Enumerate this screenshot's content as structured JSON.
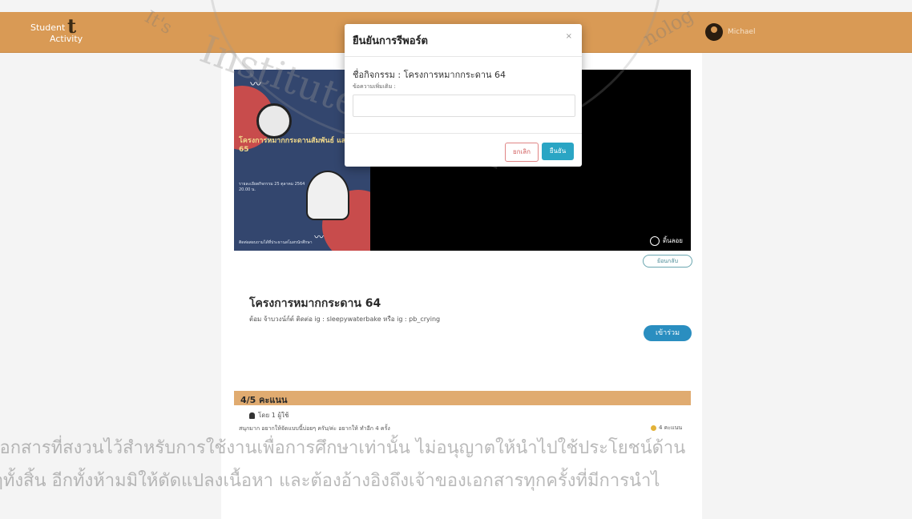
{
  "app": {
    "brand_line1": "Student",
    "brand_line2": "Activity",
    "brand_big": "t",
    "user_name": "Michael"
  },
  "activity": {
    "poster_title": "โครงการหมากกระดานสัมพันธ์ แสนสนุก 65",
    "poster_details": "รายละเอียดกิจกรรม 25 ตุลาคม 2564 20.00 น.",
    "poster_footer": "ติดต่อสอบถามได้ที่ประธานสโมสรนักศึกษา",
    "poster_shared_label": "ดิ้นลอย",
    "sub_button": "ย้อนกลับ",
    "title": "โครงการหมากกระดาน 64",
    "contact": "ต้อม จ้าบวงน์ก์ต์ ติดต่อ ig : sleepywaterbake หรือ ig : pb_crying",
    "join_button": "เข้าร่วม",
    "score": "4/5 คะแนน",
    "reviewers": "โดย 1 ผู้ใช้",
    "review_text": "สนุกมาก อยากให้จัดแบบนี้บ่อยๆ ครับ/ค่ะ อยากให้ ทำอีก 4 ครั้ง",
    "review_score": "4 คะแนน"
  },
  "modal": {
    "title": "ยืนยันการรีพอร์ต",
    "close": "×",
    "activity_label": "ชื่อกิจกรรม : โครงการหมากกระดาน 64",
    "note_label": "ข้อความเพิ่มเติม :",
    "cancel": "ยกเลิก",
    "confirm": "ยืนยัน"
  },
  "watermark": {
    "institute": "Institute of Tech",
    "arc_prefix": "It's",
    "arc_suffix": "nolog",
    "thai_line1": "เอกสารที่สงวนไว้สำหรับการใช้งานเพื่อการศึกษาเท่านั้น ไม่อนุญาตให้นำไปใช้ประโยชน์ด้าน",
    "thai_line2": "ๆทั้งสิ้น อีกทั้งห้ามมิให้ดัดแปลงเนื้อหา และต้องอ้างอิงถึงเจ้าของเอกสารทุกครั้งที่มีการนำไ"
  },
  "colors": {
    "topbar": "#d99a55",
    "score_bar": "#e0ab70",
    "confirm": "#2aa5c4",
    "cancel": "#d26060",
    "join": "#2a8ec0"
  }
}
